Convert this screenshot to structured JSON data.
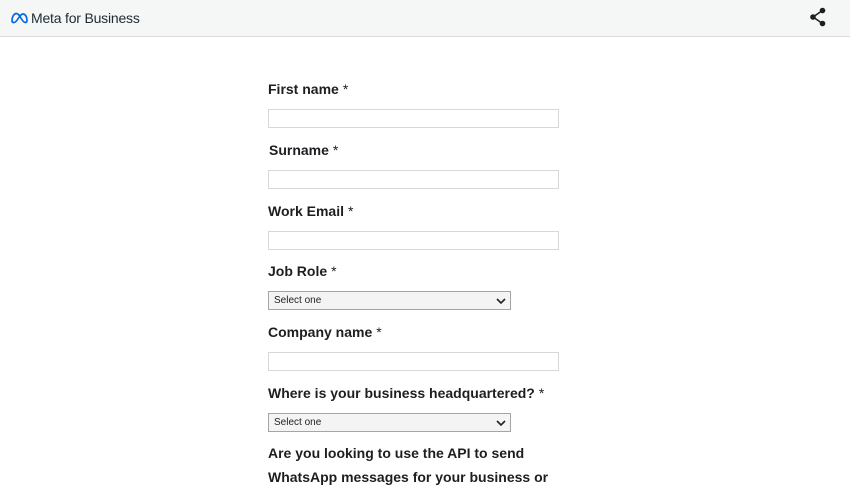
{
  "header": {
    "brand": "Meta for Business",
    "icons": {
      "logo": "meta-infinity-logo",
      "share": "share-icon"
    }
  },
  "form": {
    "required_mark": "*",
    "first_name": {
      "label": "First name",
      "value": ""
    },
    "surname": {
      "label": "Surname",
      "value": ""
    },
    "work_email": {
      "label": "Work Email",
      "value": ""
    },
    "job_role": {
      "label": "Job Role",
      "selected": "Select one"
    },
    "company_name": {
      "label": "Company name",
      "value": ""
    },
    "headquarters": {
      "label": "Where is your business headquartered?",
      "selected": "Select one"
    },
    "api_question": {
      "line1": "Are you looking to use the API to send",
      "line2": "WhatsApp messages for your business or"
    }
  },
  "colors": {
    "header_bg": "#f5f6f6",
    "logo_blue": "#0668e1",
    "text": "#1c1e21"
  }
}
